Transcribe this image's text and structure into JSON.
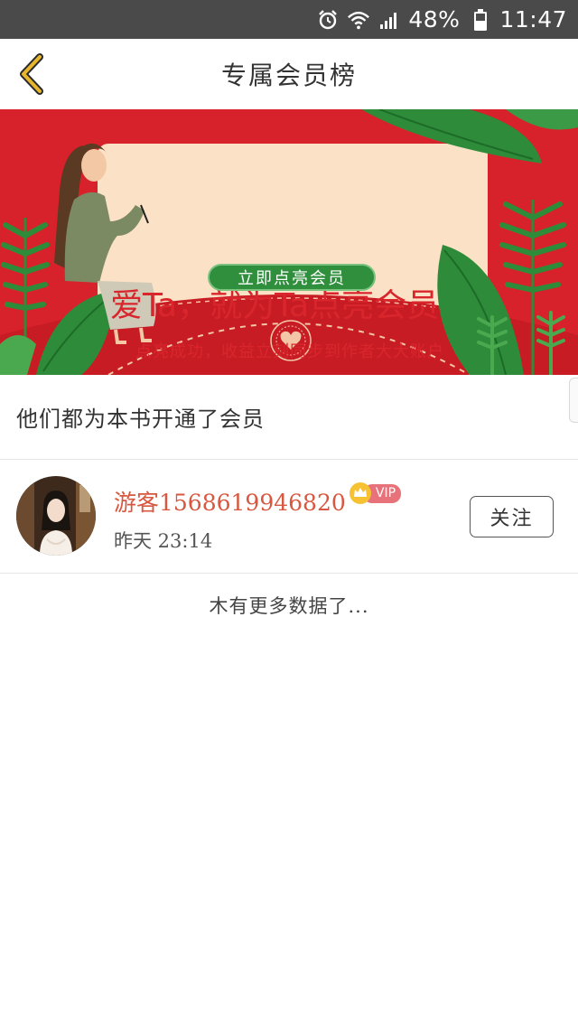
{
  "status_bar": {
    "battery_percent": "48%",
    "time": "11:47",
    "icons": [
      "alarm-icon",
      "wifi-icon",
      "signal-icon",
      "battery-icon"
    ]
  },
  "header": {
    "title": "专属会员榜",
    "back_icon": "chevron-left-icon",
    "back_icon_color": "#e7b62c"
  },
  "banner": {
    "title": "爱Ta，就为Ta点亮会员",
    "subtitle": "点亮成功，收益立刻同步到作者大大账户",
    "cta_label": "立即点亮会员",
    "colors": {
      "background": "#d7222b",
      "card": "#fbe1c6",
      "leaf": "#2e8b3a",
      "accent": "#d9262c"
    }
  },
  "section": {
    "heading": "他们都为本书开通了会员"
  },
  "members": [
    {
      "name": "游客1568619946820",
      "badge": "VIP",
      "time": "昨天 23:14",
      "follow_label": "关注"
    }
  ],
  "footer": {
    "no_more_text": "木有更多数据了..."
  }
}
